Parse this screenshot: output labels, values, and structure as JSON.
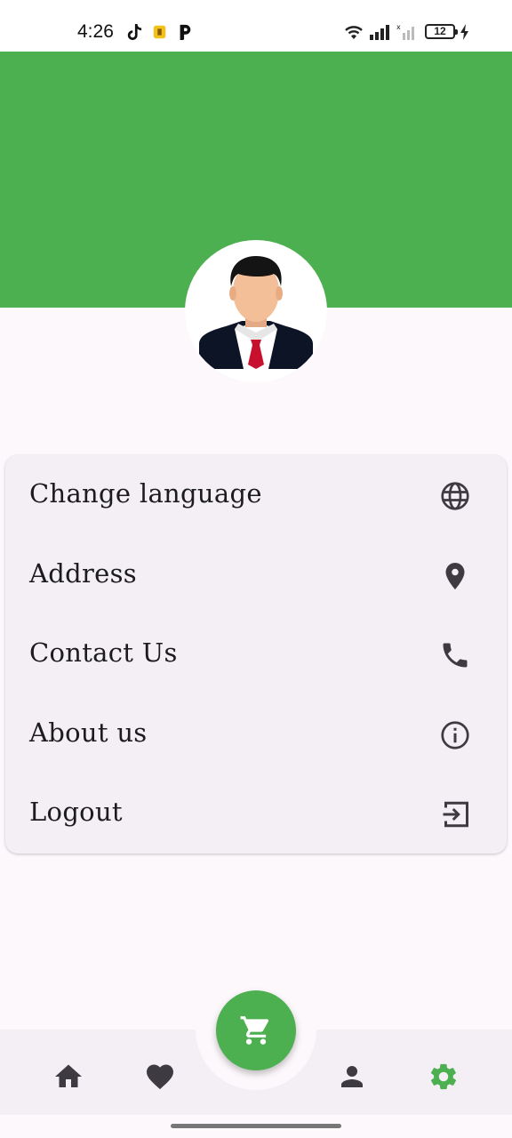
{
  "status_bar": {
    "time": "4:26",
    "battery_level": "12",
    "icons": [
      "tiktok-icon",
      "notification-app-icon",
      "pandora-icon",
      "wifi-icon",
      "signal-icon",
      "signal-no-service-icon",
      "battery-icon",
      "charging-icon"
    ]
  },
  "colors": {
    "primary": "#4caf50",
    "background": "#fdf8fc",
    "surface": "#f3eff5",
    "icon": "#3d3a41"
  },
  "menu": {
    "items": [
      {
        "label": "Change language",
        "icon": "globe-icon"
      },
      {
        "label": "Address",
        "icon": "location-pin-icon"
      },
      {
        "label": "Contact Us",
        "icon": "phone-icon"
      },
      {
        "label": "About us",
        "icon": "info-icon"
      },
      {
        "label": "Logout",
        "icon": "logout-icon"
      }
    ]
  },
  "bottom_nav": {
    "items": [
      "home-icon",
      "heart-icon",
      "cart-icon",
      "person-icon",
      "settings-icon"
    ],
    "active": "settings-icon"
  }
}
